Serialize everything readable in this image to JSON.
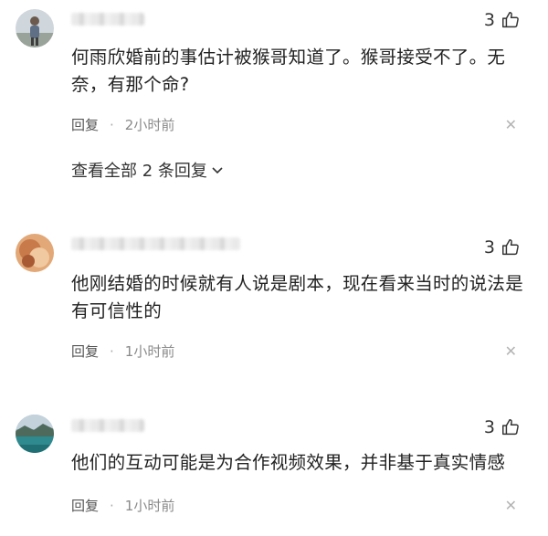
{
  "comments": [
    {
      "likes": "3",
      "text": "何雨欣婚前的事估计被猴哥知道了。猴哥接受不了。无奈，有那个命?",
      "reply_label": "回复",
      "time": "2小时前",
      "view_all": "查看全部 2 条回复"
    },
    {
      "likes": "3",
      "text": "他刚结婚的时候就有人说是剧本，现在看来当时的说法是有可信性的",
      "reply_label": "回复",
      "time": "1小时前"
    },
    {
      "likes": "3",
      "text": "他们的互动可能是为合作视频效果，并非基于真实情感",
      "reply_label": "回复",
      "time": "1小时前"
    }
  ],
  "icons": {
    "like": "thumbs-up-icon",
    "close": "close-icon",
    "expand": "chevron-down-icon"
  }
}
